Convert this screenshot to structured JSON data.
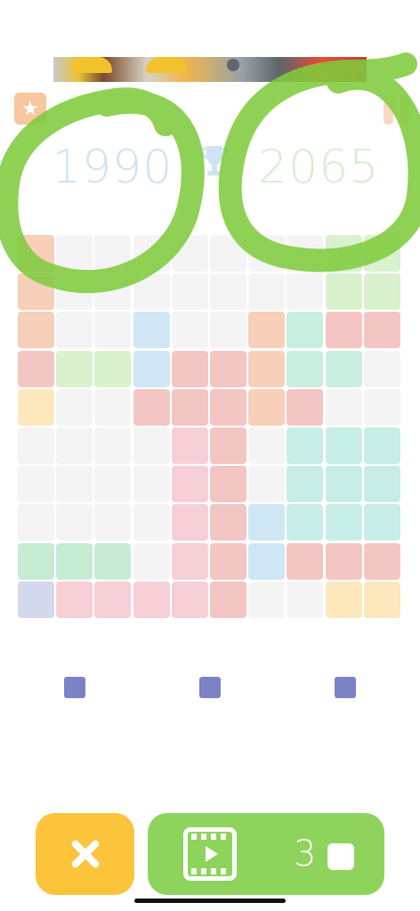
{
  "scores": {
    "current": "1990",
    "best": "2065"
  },
  "colors": {
    "empty": "#f4f4f4",
    "orange": "#f7d3bd",
    "peach": "#f8cfb8",
    "green": "#d9f1cd",
    "blue": "#cfe6f4",
    "red": "#f3c6c3",
    "pink": "#f6cfd6",
    "mint": "#c8eedf",
    "teal": "#c6eee6",
    "yellow": "#fde7bc",
    "lavender": "#d3d8ec",
    "emerald": "#c7ecd4",
    "white": "#f5f5f5",
    "piece": "#7b83c6",
    "highlight": "#7fcb3e"
  },
  "board": {
    "rows": 10,
    "cols": 10,
    "grid": [
      [
        "peach",
        "empty",
        "empty",
        "empty",
        "empty",
        "empty",
        "empty",
        "empty",
        "green",
        "green"
      ],
      [
        "peach",
        "empty",
        "empty",
        "empty",
        "empty",
        "empty",
        "empty",
        "empty",
        "green",
        "green"
      ],
      [
        "peach",
        "empty",
        "empty",
        "blue",
        "empty",
        "empty",
        "peach",
        "mint",
        "red",
        "red"
      ],
      [
        "red",
        "green",
        "green",
        "blue",
        "red",
        "red",
        "peach",
        "mint",
        "mint",
        "empty"
      ],
      [
        "yellow",
        "empty",
        "empty",
        "red",
        "red",
        "red",
        "peach",
        "red",
        "empty",
        "empty"
      ],
      [
        "empty",
        "empty",
        "empty",
        "empty",
        "pink",
        "red",
        "empty",
        "teal",
        "teal",
        "teal"
      ],
      [
        "empty",
        "empty",
        "empty",
        "empty",
        "pink",
        "red",
        "empty",
        "teal",
        "teal",
        "teal"
      ],
      [
        "empty",
        "empty",
        "empty",
        "empty",
        "pink",
        "red",
        "blue",
        "teal",
        "teal",
        "teal"
      ],
      [
        "emerald",
        "emerald",
        "emerald",
        "empty",
        "pink",
        "red",
        "blue",
        "red",
        "red",
        "red"
      ],
      [
        "lavender",
        "pink",
        "pink",
        "pink",
        "pink",
        "red",
        "white",
        "white",
        "yellow",
        "yellow"
      ]
    ]
  },
  "pieces": [
    "piece",
    "piece",
    "piece"
  ],
  "buttons": {
    "close_icon": "close-icon",
    "video_icon": "film-play-icon",
    "video_count": "3",
    "block_icon": "block-icon"
  },
  "icons": {
    "star": "star-icon",
    "pause": "pause-icon",
    "trophy": "trophy-icon"
  }
}
